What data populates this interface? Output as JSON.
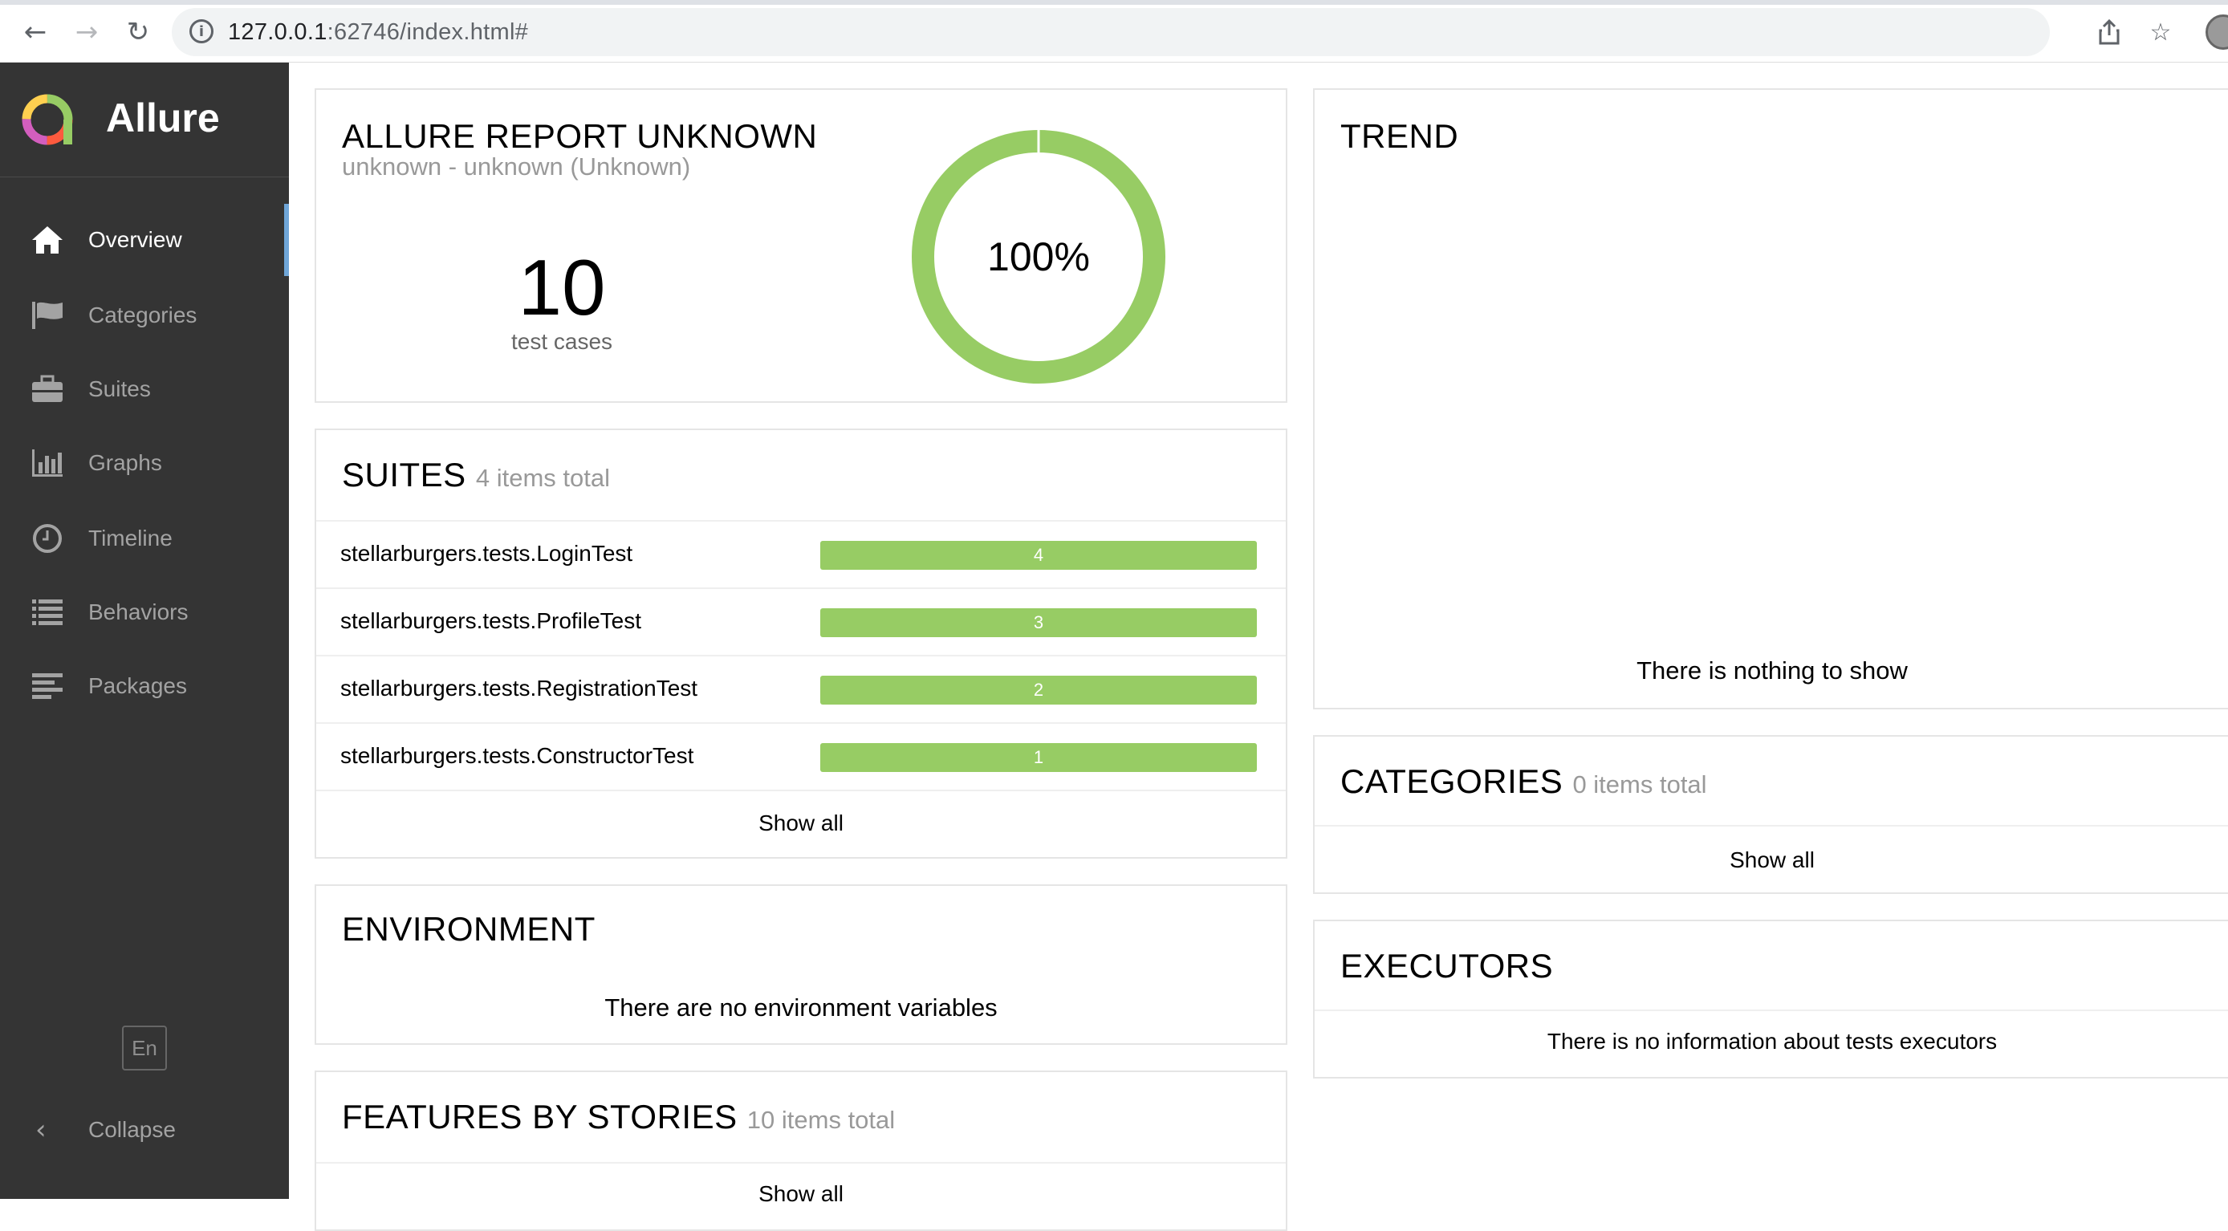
{
  "browser": {
    "url_host": "127.0.0.1",
    "url_path": ":62746/index.html#"
  },
  "sidebar": {
    "brand": "Allure",
    "items": [
      {
        "label": "Overview",
        "icon": "home-icon",
        "active": true
      },
      {
        "label": "Categories",
        "icon": "flag-icon",
        "active": false
      },
      {
        "label": "Suites",
        "icon": "briefcase-icon",
        "active": false
      },
      {
        "label": "Graphs",
        "icon": "bar-chart-icon",
        "active": false
      },
      {
        "label": "Timeline",
        "icon": "clock-icon",
        "active": false
      },
      {
        "label": "Behaviors",
        "icon": "list-icon",
        "active": false
      },
      {
        "label": "Packages",
        "icon": "align-left-icon",
        "active": false
      }
    ],
    "language": "En",
    "collapse_label": "Collapse"
  },
  "summary": {
    "title": "ALLURE REPORT UNKNOWN",
    "subtitle": "unknown - unknown (Unknown)",
    "test_count": "10",
    "test_count_label": "test cases",
    "percent_label": "100%",
    "pass_fraction": 1.0,
    "pass_color": "#97cc64"
  },
  "suites": {
    "title": "SUITES",
    "total": "4 items total",
    "rows": [
      {
        "name": "stellarburgers.tests.LoginTest",
        "count": "4"
      },
      {
        "name": "stellarburgers.tests.ProfileTest",
        "count": "3"
      },
      {
        "name": "stellarburgers.tests.RegistrationTest",
        "count": "2"
      },
      {
        "name": "stellarburgers.tests.ConstructorTest",
        "count": "1"
      }
    ],
    "show_all": "Show all"
  },
  "environment": {
    "title": "ENVIRONMENT",
    "empty": "There are no environment variables"
  },
  "features": {
    "title": "FEATURES BY STORIES",
    "total": "10 items total",
    "show_all": "Show all"
  },
  "trend": {
    "title": "TREND",
    "empty": "There is nothing to show"
  },
  "categories": {
    "title": "CATEGORIES",
    "total": "0 items total",
    "show_all": "Show all"
  },
  "executors": {
    "title": "EXECUTORS",
    "empty": "There is no information about tests executors"
  }
}
